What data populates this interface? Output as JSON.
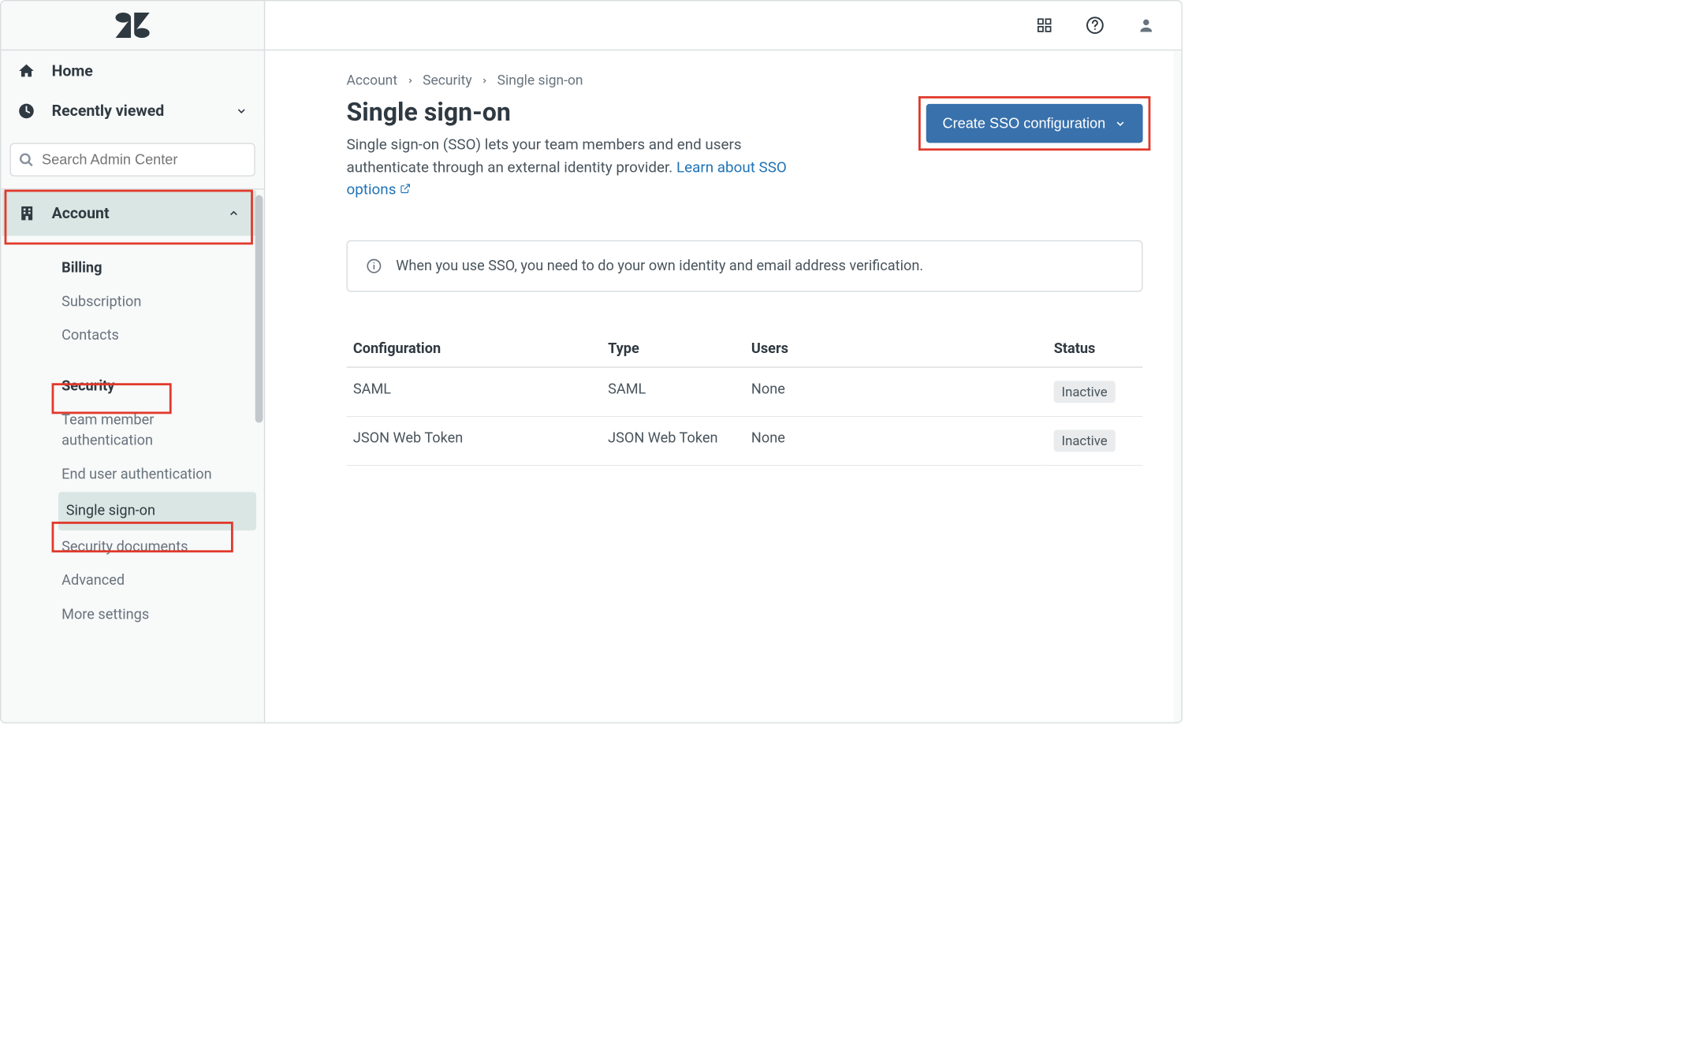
{
  "sidebar": {
    "home": "Home",
    "recently_viewed": "Recently viewed",
    "search_placeholder": "Search Admin Center",
    "section_label": "Account",
    "items": [
      {
        "label": "Billing",
        "bold": true
      },
      {
        "label": "Subscription"
      },
      {
        "label": "Contacts"
      },
      {
        "label": "Security",
        "bold": true
      },
      {
        "label": "Team member authentication"
      },
      {
        "label": "End user authentication"
      },
      {
        "label": "Single sign-on",
        "active": true
      },
      {
        "label": "Security documents"
      },
      {
        "label": "Advanced"
      },
      {
        "label": "More settings"
      }
    ]
  },
  "topbar": {},
  "breadcrumbs": [
    "Account",
    "Security",
    "Single sign-on"
  ],
  "page": {
    "title": "Single sign-on",
    "description_before": "Single sign-on (SSO) lets your team members and end users authenticate through an external identity provider. ",
    "link_text": "Learn about SSO options",
    "create_button": "Create SSO configuration",
    "info": "When you use SSO, you need to do your own identity and email address verification."
  },
  "table": {
    "headers": {
      "config": "Configuration",
      "type": "Type",
      "users": "Users",
      "status": "Status"
    },
    "rows": [
      {
        "config": "SAML",
        "type": "SAML",
        "users": "None",
        "status": "Inactive"
      },
      {
        "config": "JSON Web Token",
        "type": "JSON Web Token",
        "users": "None",
        "status": "Inactive"
      }
    ]
  }
}
